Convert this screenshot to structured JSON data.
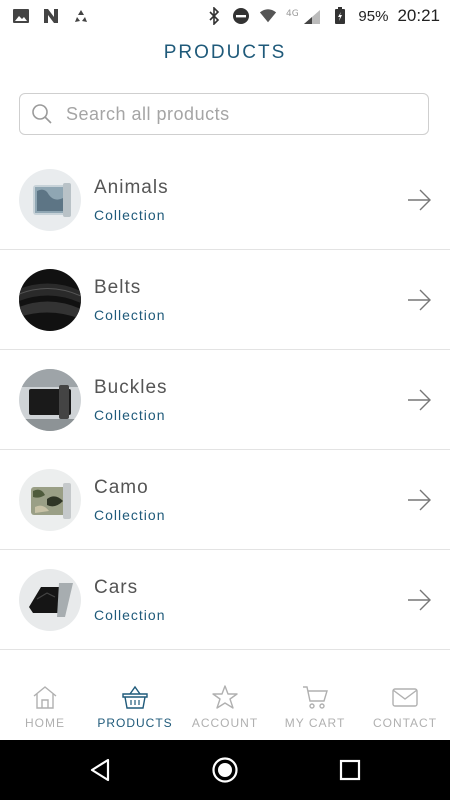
{
  "status_bar": {
    "battery": "95%",
    "time": "20:21",
    "network": "4G"
  },
  "title": "PRODUCTS",
  "search": {
    "placeholder": "Search all products"
  },
  "products": [
    {
      "name": "Animals",
      "sub": "Collection"
    },
    {
      "name": "Belts",
      "sub": "Collection"
    },
    {
      "name": "Buckles",
      "sub": "Collection"
    },
    {
      "name": "Camo",
      "sub": "Collection"
    },
    {
      "name": "Cars",
      "sub": "Collection"
    }
  ],
  "nav": [
    {
      "label": "HOME",
      "icon": "home-icon"
    },
    {
      "label": "PRODUCTS",
      "icon": "basket-icon",
      "active": true
    },
    {
      "label": "ACCOUNT",
      "icon": "star-icon"
    },
    {
      "label": "MY CART",
      "icon": "cart-icon"
    },
    {
      "label": "CONTACT",
      "icon": "mail-icon"
    }
  ],
  "colors": {
    "accent": "#1f5a7a",
    "muted": "#b0b0b0",
    "divider": "#e3e3e3"
  }
}
